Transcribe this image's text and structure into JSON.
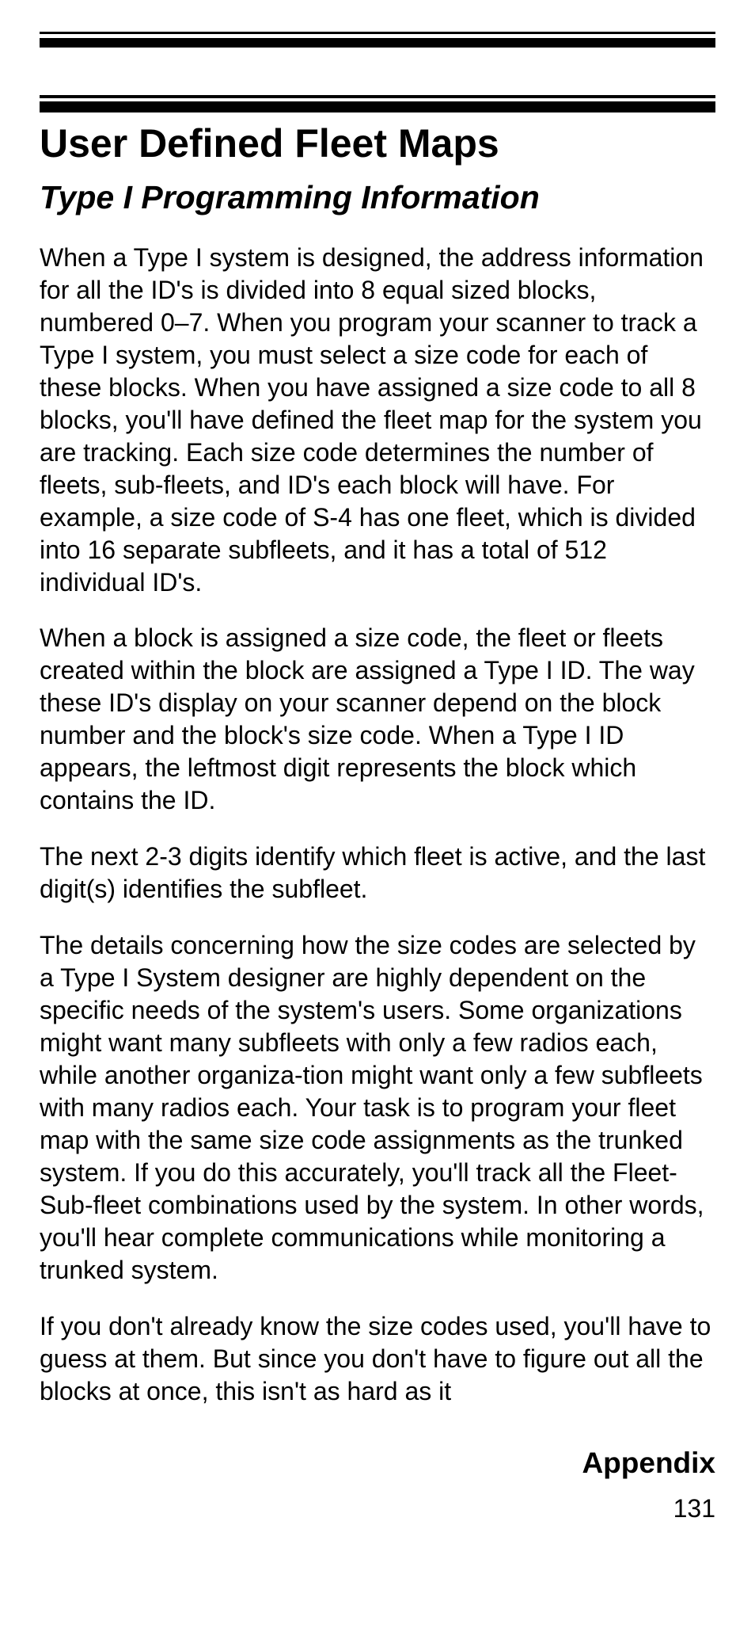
{
  "heading": "User Defined Fleet Maps",
  "subheading": "Type I Programming Information",
  "paragraphs": [
    "When a Type I system is designed, the address information for all the ID's is divided into 8 equal sized blocks, numbered 0–7. When you program your scanner to track a Type I system, you must select a size code for each of these blocks. When you have assigned a size code to all 8 blocks, you'll have defined the fleet map for the system you are tracking. Each size code determines the number of fleets, sub-fleets, and ID's each block will have. For example, a size code of S-4 has one fleet, which is divided into 16 separate subfleets, and it has a total of 512 individual ID's.",
    "When a block is assigned a size code, the fleet or fleets created within the block are assigned a Type I ID. The way these ID's display on your scanner depend on the block number and the block's size code. When a Type I ID appears, the leftmost digit represents the block which contains the ID.",
    "The next 2-3 digits identify which fleet is active, and the last digit(s) identifies the subfleet.",
    "The details concerning how the size codes are selected by a Type I System designer are highly dependent on the specific needs of the system's users. Some organizations might want many subfleets with only a few radios each, while another organiza-tion might want only a few subfleets with many radios each. Your task is to program your fleet map with the same size code assignments as the trunked system. If you do this accurately, you'll track all the Fleet-Sub-fleet combinations used by the system. In other words, you'll hear complete communications while monitoring a trunked system.",
    "If you don't already know the size codes used, you'll have to guess at them. But since you don't have to figure out all the blocks at once, this isn't as hard as it"
  ],
  "footer_label": "Appendix",
  "page_number": "131"
}
